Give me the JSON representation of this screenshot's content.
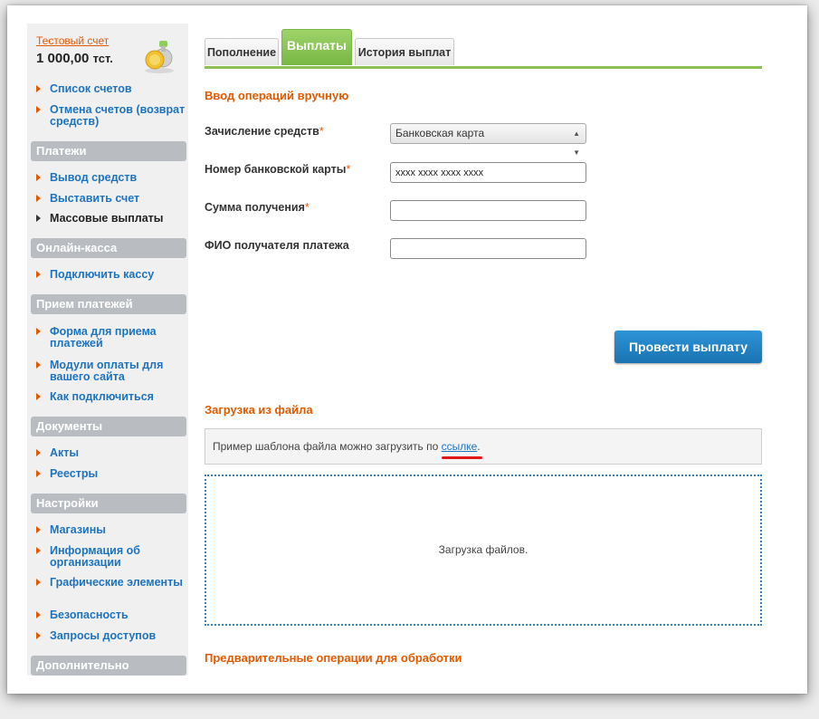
{
  "account": {
    "link": "Тестовый счет",
    "balance": "1 000,00",
    "currency": "тст."
  },
  "sidebar": {
    "top_items": [
      "Список счетов",
      "Отмена счетов (возврат средств)"
    ],
    "sections": [
      {
        "title": "Платежи",
        "items": [
          "Вывод средств",
          "Выставить счет",
          "Массовые выплаты"
        ],
        "active": "Массовые выплаты"
      },
      {
        "title": "Онлайн-касса",
        "items": [
          "Подключить кассу"
        ]
      },
      {
        "title": "Прием платежей",
        "items": [
          "Форма для приема платежей",
          "Модули оплаты для вашего сайта",
          "Как подключиться"
        ]
      },
      {
        "title": "Документы",
        "items": [
          "Акты",
          "Реестры"
        ]
      },
      {
        "title": "Настройки",
        "items": [
          "Магазины",
          "Информация об организации",
          "Графические элементы",
          "Безопасность",
          "Запросы доступов"
        ]
      },
      {
        "title": "Дополнительно",
        "items": []
      }
    ]
  },
  "tabs": [
    {
      "label": "Пополнение",
      "active": false
    },
    {
      "label": "Выплаты",
      "active": true
    },
    {
      "label": "История выплат",
      "active": false
    }
  ],
  "manual": {
    "title": "Ввод операций вручную",
    "fields": [
      {
        "label": "Зачисление средств",
        "required": "*",
        "type": "select",
        "value": "Банковская карта"
      },
      {
        "label": "Номер банковской карты",
        "required": "*",
        "type": "input",
        "value": "xxxx xxxx xxxx xxxx"
      },
      {
        "label": "Сумма получения",
        "required": "*",
        "type": "input",
        "value": ""
      },
      {
        "label": "ФИО получателя платежа",
        "required": "",
        "type": "input",
        "value": ""
      }
    ],
    "submit_label": "Провести выплату"
  },
  "upload": {
    "title": "Загрузка из файла",
    "hint_prefix": "Пример шаблона файла можно загрузить по ",
    "hint_link": "ссылке",
    "hint_suffix": ".",
    "drop_zone_text": "Загрузка файлов."
  },
  "pending": {
    "title": "Предварительные операции для обработки"
  },
  "colors": {
    "accent_orange": "#e25a00",
    "link_blue": "#1e73be",
    "tab_green": "#8cc251",
    "button_blue": "#1a73b3",
    "highlight_red": "#e01818"
  }
}
